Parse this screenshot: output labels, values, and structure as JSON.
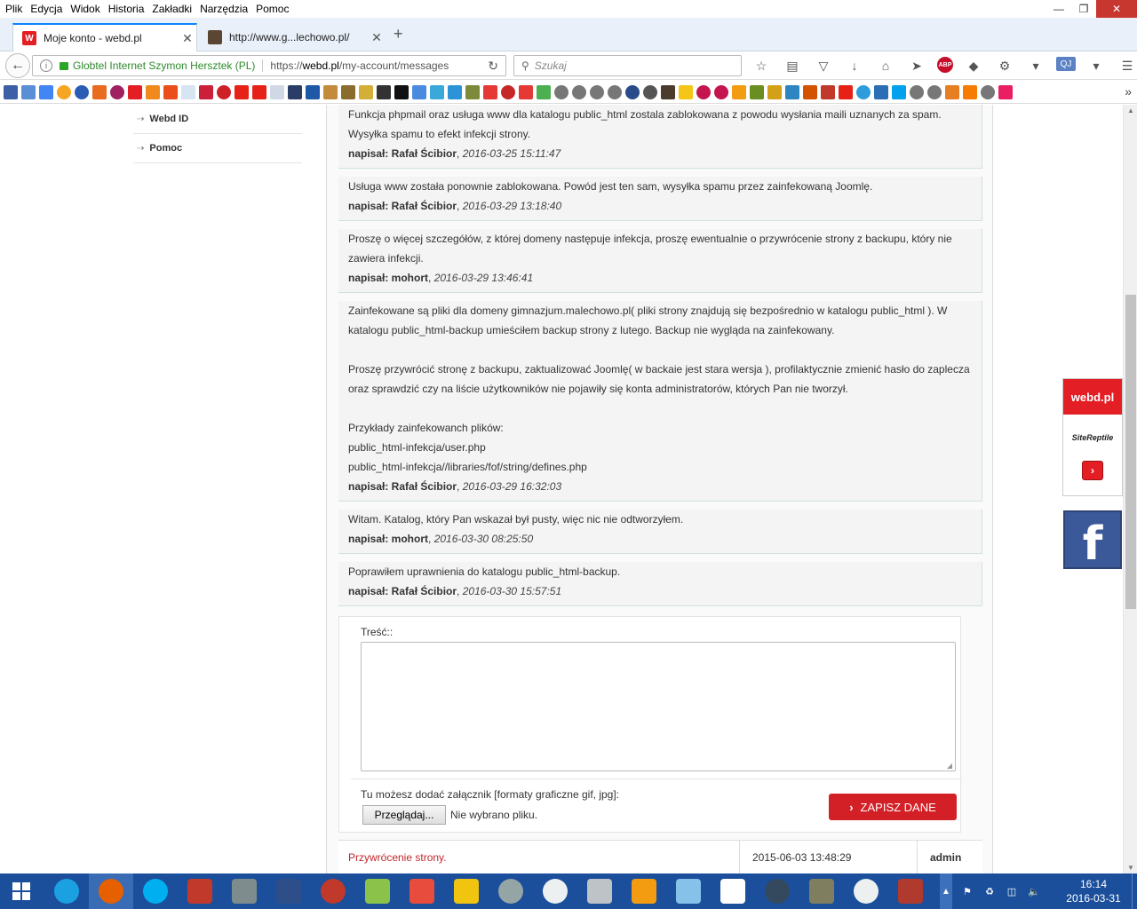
{
  "menubar": {
    "items": [
      "Plik",
      "Edycja",
      "Widok",
      "Historia",
      "Zakładki",
      "Narzędzia",
      "Pomoc"
    ]
  },
  "window_controls": {
    "minimize": "—",
    "restore": "❐",
    "close": "✕"
  },
  "tabs": [
    {
      "title": "Moje konto - webd.pl",
      "favicon": "webd-logo-icon",
      "active": true
    },
    {
      "title": "http://www.g...lechowo.pl/",
      "favicon": "person-photo-icon",
      "active": false
    }
  ],
  "tab_close_glyph": "✕",
  "new_tab_glyph": "+",
  "navbar": {
    "identity": "Globtel Internet Szymon Hersztek (PL)",
    "url_prefix": "https://",
    "url_domain": "webd.pl",
    "url_path": "/my-account/messages",
    "search_placeholder": "Szukaj",
    "abp_label": "ABP",
    "qj_label": "QJ"
  },
  "sidebar": {
    "items": [
      {
        "label": "Webd ID"
      },
      {
        "label": "Pomoc"
      }
    ]
  },
  "messages": [
    {
      "lines": [
        "Funkcja phpmail oraz usługa www dla katalogu public_html zostala zablokowana z powodu wysłania maili uznanych za spam.",
        "Wysyłka spamu to efekt infekcji strony."
      ],
      "signature_prefix": "napisał: Rafał Ścibior",
      "timestamp": "2016-03-25 15:11:47"
    },
    {
      "lines": [
        "Usługa www została ponownie zablokowana. Powód jest ten sam, wysyłka spamu przez zainfekowaną Joomlę."
      ],
      "signature_prefix": "napisał: Rafał Ścibior",
      "timestamp": "2016-03-29 13:18:40"
    },
    {
      "lines": [
        "Proszę o więcej szczegółów, z której domeny następuje infekcja, proszę ewentualnie o przywrócenie strony z backupu, który nie",
        "zawiera infekcji."
      ],
      "signature_prefix": "napisał: mohort",
      "timestamp": "2016-03-29 13:46:41"
    },
    {
      "lines": [
        "Zainfekowane są pliki dla domeny gimnazjum.malechowo.pl( pliki strony znajdują się bezpośrednio w katalogu public_html ). W",
        "katalogu public_html-backup umieściłem backup strony z lutego. Backup nie wygląda na zainfekowany.",
        "",
        "Proszę przywrócić stronę z backupu, zaktualizować Joomlę( w backaie jest stara wersja ), profilaktycznie zmienić hasło do zaplecza",
        "oraz sprawdzić czy na liście użytkowników nie pojawiły się konta administratorów, których Pan nie tworzył.",
        "",
        "Przykłady zainfekowanch plików:",
        "public_html-infekcja/user.php",
        "public_html-infekcja//libraries/fof/string/defines.php"
      ],
      "signature_prefix": "napisał: Rafał Ścibior",
      "timestamp": "2016-03-29 16:32:03"
    },
    {
      "lines": [
        "Witam. Katalog, który Pan wskazał był pusty, więc nic nie odtworzyłem."
      ],
      "signature_prefix": "napisał: mohort",
      "timestamp": "2016-03-30 08:25:50"
    },
    {
      "lines": [
        "Poprawiłem uprawnienia do katalogu public_html-backup."
      ],
      "signature_prefix": "napisał: Rafał Ścibior",
      "timestamp": "2016-03-30 15:57:51"
    }
  ],
  "reply_form": {
    "content_label": "Treść::",
    "content_value": "",
    "attachment_label": "Tu możesz dodać załącznik [formaty graficzne gif, jpg]:",
    "browse_label": "Przeglądaj...",
    "no_file_label": "Nie wybrano pliku.",
    "save_label": "ZAPISZ DANE"
  },
  "thread_row": {
    "subject": "Przywrócenie strony.",
    "date": "2015-06-03 13:48:29",
    "author": "admin"
  },
  "side_widget": {
    "brand": "webd.pl",
    "partner": "SiteReptile"
  },
  "taskbar": {
    "time": "16:14",
    "date": "2016-03-31"
  },
  "colors": {
    "accent_red": "#d31f26",
    "taskbar_blue": "#1b4f9c",
    "subject_red": "#c1272d",
    "identity_green": "#2d8a2d",
    "facebook_blue": "#3b5998"
  }
}
